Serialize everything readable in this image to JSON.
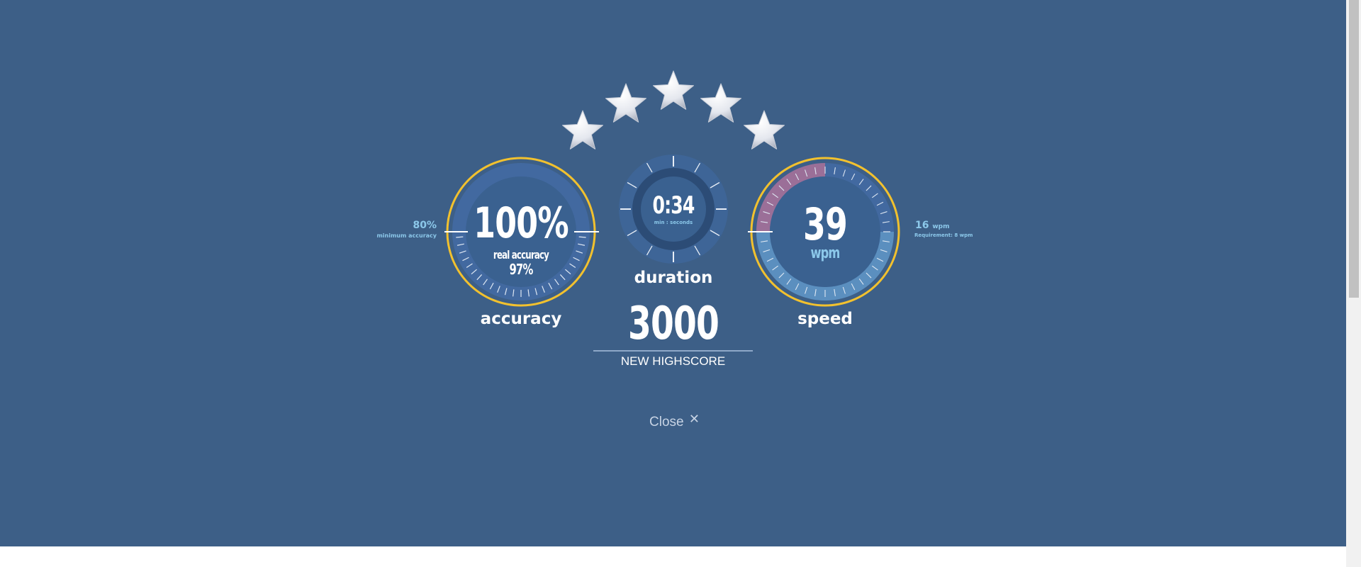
{
  "rating": {
    "stars_total": 5,
    "stars_earned": 5
  },
  "accuracy": {
    "value": "100%",
    "value_fraction": 1.0,
    "real_accuracy_label": "real accuracy",
    "real_accuracy_value": "97%",
    "minimum_value": "80%",
    "minimum_label": "minimum accuracy",
    "label": "accuracy"
  },
  "duration": {
    "value": "0:34",
    "unit_label": "min : seconds",
    "label": "duration"
  },
  "speed": {
    "value": "39",
    "unit": "wpm",
    "requirement_value": "16",
    "requirement_unit": "wpm",
    "requirement_label": "Requirement: 8 wpm",
    "label": "speed"
  },
  "score": {
    "value": "3000",
    "caption": "NEW HIGHSCORE"
  },
  "close": {
    "label": "Close",
    "icon": "close-icon"
  },
  "colors": {
    "background": "#3d5f87",
    "ring_gold": "#f2c12e",
    "gauge_dark": "#2d4d77",
    "gauge_mid": "#3f669a",
    "speed_fill": "#5b8fbf",
    "speed_pink": "#9b6f98",
    "accent_blue": "#8cc8ea"
  }
}
